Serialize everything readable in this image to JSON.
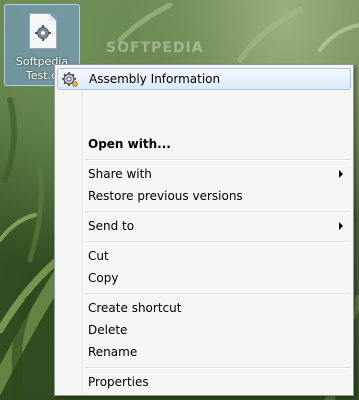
{
  "desktop": {
    "icon_label_line1": "Softpedia",
    "icon_label_line2": "Test.d",
    "watermark": "SOFTPEDIA",
    "wallpaper_colors": [
      "#6a8650",
      "#4f6d38",
      "#314a20"
    ]
  },
  "context_menu": {
    "items": [
      {
        "label": "Assembly Information",
        "icon": "gear-icon",
        "highlighted": true
      },
      {
        "label": "Open with...",
        "bold": true
      },
      {
        "label": "Share with",
        "submenu": true
      },
      {
        "label": "Restore previous versions"
      },
      {
        "label": "Send to",
        "submenu": true
      },
      {
        "label": "Cut"
      },
      {
        "label": "Copy"
      },
      {
        "label": "Create shortcut"
      },
      {
        "label": "Delete"
      },
      {
        "label": "Rename"
      },
      {
        "label": "Properties"
      }
    ],
    "highlight_color": "#dde9f7",
    "border_color": "#979797"
  }
}
